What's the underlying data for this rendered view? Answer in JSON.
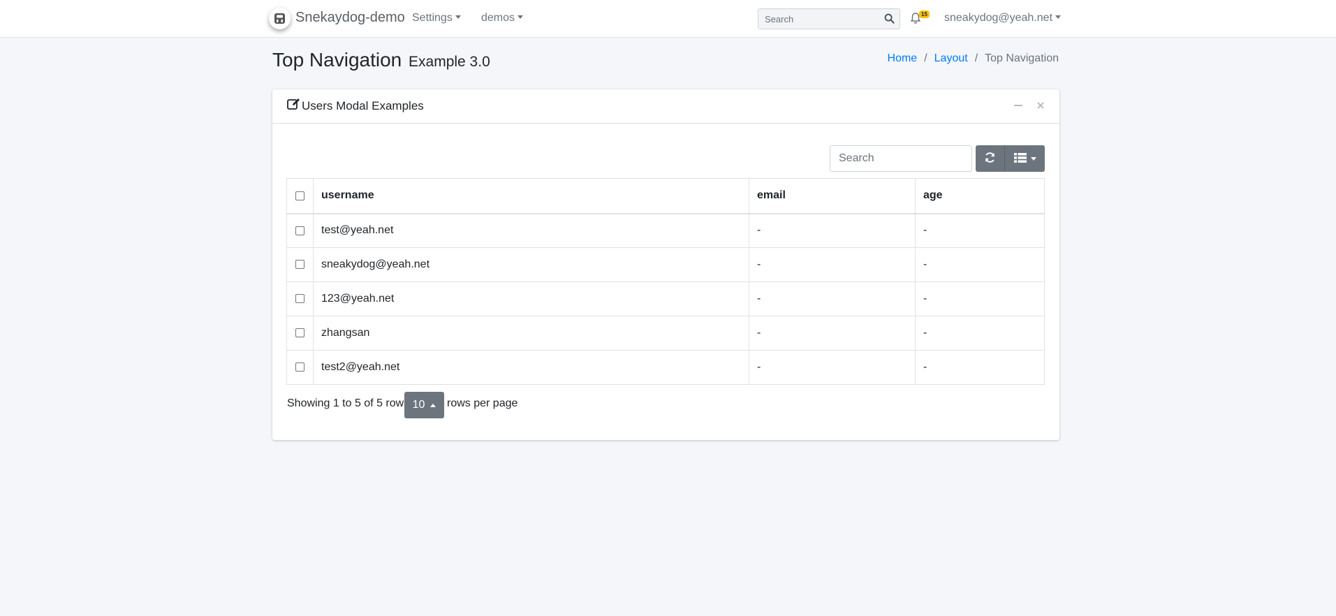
{
  "navbar": {
    "brand": "Snekaydog-demo",
    "menu": [
      {
        "label": "Settings"
      },
      {
        "label": "demos"
      }
    ],
    "search_placeholder": "Search",
    "notifications_count": "15",
    "user": "sneakydog@yeah.net"
  },
  "header": {
    "title": "Top Navigation",
    "subtitle": "Example 3.0",
    "breadcrumb": [
      "Home",
      "Layout",
      "Top Navigation"
    ]
  },
  "card": {
    "title": "Users Modal Examples",
    "search_placeholder": "Search",
    "table": {
      "columns": [
        "username",
        "email",
        "age"
      ],
      "rows": [
        {
          "username": "test@yeah.net",
          "email": "-",
          "age": "-"
        },
        {
          "username": "sneakydog@yeah.net",
          "email": "-",
          "age": "-"
        },
        {
          "username": "123@yeah.net",
          "email": "-",
          "age": "-"
        },
        {
          "username": "zhangsan",
          "email": "-",
          "age": "-"
        },
        {
          "username": "test2@yeah.net",
          "email": "-",
          "age": "-"
        }
      ]
    },
    "pagination": {
      "info": "Showing 1 to 5 of 5 rows",
      "page_size": "10",
      "after": "rows per page"
    }
  },
  "icons": {
    "brand": "brand-logo-icon",
    "search": "search-icon",
    "notifications": "bell-icon",
    "card_title": "edit-icon",
    "collapse": "minus-icon",
    "remove": "close-icon",
    "refresh": "refresh-icon",
    "columns": "list-icon"
  },
  "colors": {
    "link": "#007bff",
    "button": "#6c757d",
    "badge": "#ffc107",
    "background": "#f4f6f9"
  }
}
